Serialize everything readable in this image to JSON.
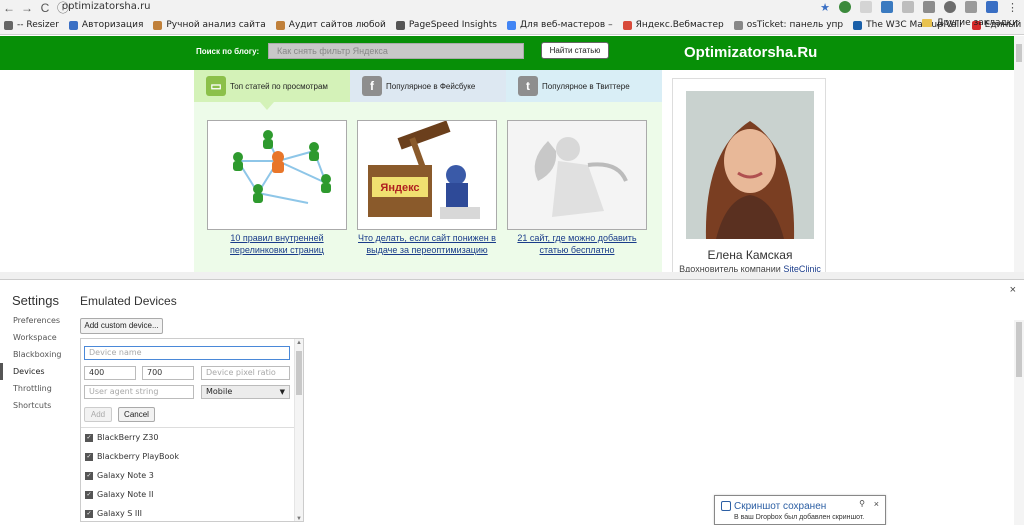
{
  "browser": {
    "url": "optimizatorsha.ru",
    "back_icon": "←",
    "forward_icon": "→",
    "reload_icon": "C",
    "bookmarks": [
      {
        "label": "-- Resizer",
        "color": "#666666"
      },
      {
        "label": "Авторизация",
        "color": "#3a6fc4"
      },
      {
        "label": "Ручной анализ сайта",
        "color": "#c0803a"
      },
      {
        "label": "Аудит сайтов любой",
        "color": "#c0803a"
      },
      {
        "label": "PageSpeed Insights",
        "color": "#555555"
      },
      {
        "label": "Для веб-мастеров –",
        "color": "#4285f4"
      },
      {
        "label": "Яндекс.Вебмастер",
        "color": "#d84a3a"
      },
      {
        "label": "osTicket: панель упр",
        "color": "#888888"
      },
      {
        "label": "The W3C Markup Vali",
        "color": "#1a5fa8"
      },
      {
        "label": "Единый центр обрат",
        "color": "#d42b2b"
      }
    ],
    "more_bookmarks": "»",
    "other_bookmarks": "Другие закладки"
  },
  "site": {
    "search_label": "Поиск по блогу:",
    "search_placeholder": "Как снять фильтр Яндекса",
    "search_button": "Найти статью",
    "title": "Optimizatorsha.Ru",
    "tabs": [
      {
        "label": "Топ статей по просмотрам",
        "icon": "chat-icon",
        "color": "#8cc04a"
      },
      {
        "label": "Популярное в Фейсбуке",
        "icon": "facebook-icon",
        "color": "#999999"
      },
      {
        "label": "Популярное в Твиттере",
        "icon": "twitter-icon",
        "color": "#999999"
      }
    ],
    "articles": [
      {
        "caption": "10 правил внутренней перелинковки страниц"
      },
      {
        "caption": "Что делать, если сайт понижен в выдаче за переоптимизацию текстов?"
      },
      {
        "caption": "21 сайт, где можно добавить статью бесплатно"
      }
    ],
    "yandex_label": "Яндекс",
    "author": {
      "name": "Елена Камская",
      "role": "Вдохновитель компании",
      "company": "SiteClinic"
    }
  },
  "devtools": {
    "close_icon": "×",
    "settings_title": "Settings",
    "nav": [
      "Preferences",
      "Workspace",
      "Blackboxing",
      "Devices",
      "Throttling",
      "Shortcuts"
    ],
    "active_nav": "Devices",
    "section_title": "Emulated Devices",
    "add_custom_button": "Add custom device...",
    "form": {
      "name_placeholder": "Device name",
      "width_value": "400",
      "height_value": "700",
      "dpr_placeholder": "Device pixel ratio",
      "ua_placeholder": "User agent string",
      "type_value": "Mobile",
      "add_button": "Add",
      "cancel_button": "Cancel"
    },
    "devices": [
      "BlackBerry Z30",
      "Blackberry PlayBook",
      "Galaxy Note 3",
      "Galaxy Note II",
      "Galaxy S III"
    ]
  },
  "toast": {
    "title": "Скриншот сохранен",
    "text": "В ваш Dropbox был добавлен скриншот.",
    "close": "×",
    "pin": "⚲"
  }
}
